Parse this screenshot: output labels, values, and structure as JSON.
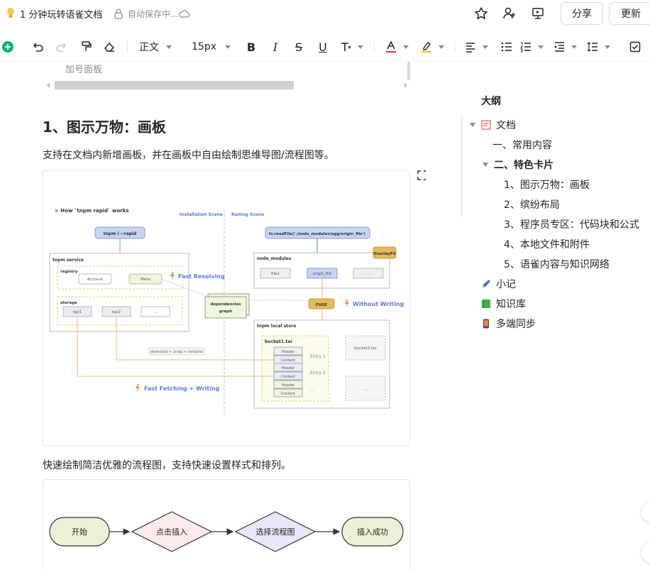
{
  "header": {
    "doc_title": "1 分钟玩转语雀文档",
    "save_status": "自动保存中...",
    "share_label": "分享",
    "update_label": "更新"
  },
  "toolbar": {
    "paragraph_style": "正文",
    "font_size": "15px"
  },
  "document": {
    "prev_panel_caption": "加号面板",
    "heading": "1、图示万物：画板",
    "para1": "支持在文档内新增画板，并在画板中自由绘制思维导图/流程图等。",
    "para2": "快速绘制简洁优雅的流程图，支持快速设置样式和排列。",
    "board1": {
      "title": "> How `tnpm rapid` works",
      "installation_scene": "Installation Scene",
      "running_scene": "Runing Scene",
      "cmd_install": "tnpm i --rapid",
      "cmd_read": "fs.readFile('./node_modules/egg/origin_file')",
      "tnpm_service": "tnpm service",
      "registry": "registry",
      "account": "Account",
      "meta": "Meta",
      "fast_resolving": "Fast Resolving",
      "storage": "storage",
      "tgz1": "tgz1",
      "tgz2": "tgz2",
      "ellipsis": "...",
      "dep_graph_1": "dependencies",
      "dep_graph_2": "graph",
      "node_modules": "node_modules",
      "overlayfs": "OverlayFS",
      "file1": "file1",
      "origin_file": "origin_file",
      "fuse": "FUSE",
      "without_writing": "Without Writing",
      "local_store": "tnpm local store",
      "bucket1": "bucket1.tar",
      "bucket2": "bucket2.tar",
      "header": "Header",
      "content": "Content",
      "entry1": "Entry 1",
      "entry2": "Entry 2",
      "download_note": "download + unzip + combine",
      "fast_fetching": "Fast Fetching + Writing"
    },
    "flow": {
      "start": "开始",
      "click_insert": "点击插入",
      "choose_flow": "选择流程图",
      "insert_success": "插入成功"
    }
  },
  "outline": {
    "title": "大纲",
    "items": [
      {
        "label": "文档"
      },
      {
        "label": "一、常用内容"
      },
      {
        "label": "二、特色卡片"
      },
      {
        "label": "1、图示万物：画板"
      },
      {
        "label": "2、缤纷布局"
      },
      {
        "label": "3、程序员专区：代码块和公式"
      },
      {
        "label": "4、本地文件和附件"
      },
      {
        "label": "5、语雀内容与知识网络"
      },
      {
        "label": "小记"
      },
      {
        "label": "知识库"
      },
      {
        "label": "多端同步"
      }
    ]
  },
  "colors": {
    "accent_green": "#00b96b",
    "lightning": "#f5814a",
    "blue_label": "#5b7bd8",
    "fuse_gold": "#e3b95b"
  }
}
